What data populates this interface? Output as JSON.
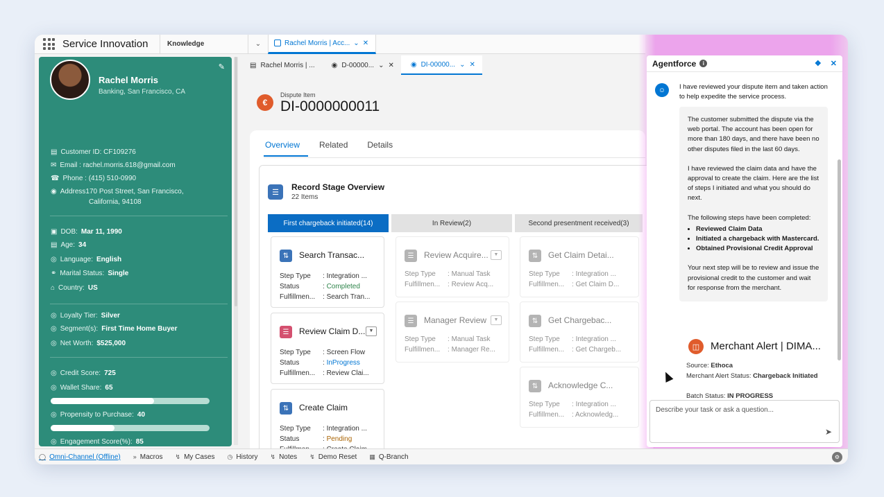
{
  "app": {
    "name": "Service Innovation",
    "nav_dropdown": "Knowledge",
    "workspace_tab": "Rachel Morris | Acc..."
  },
  "subtabs": [
    {
      "label": "Rachel Morris | ..."
    },
    {
      "label": "D-00000..."
    },
    {
      "label": "DI-00000..."
    }
  ],
  "profile": {
    "name": "Rachel Morris",
    "location": "Banking, San Francisco, CA",
    "customer_id": "Customer ID: CF109276",
    "email": "Email : rachel.morris.618@gmail.com",
    "phone": "Phone : (415) 510-0990",
    "address_line1": "Address170 Post Street, San Francisco,",
    "address_line2": "California, 94108",
    "dob_label": "DOB:",
    "dob": "Mar 11, 1990",
    "age_label": "Age:",
    "age": "34",
    "language_label": "Language:",
    "language": "English",
    "marital_label": "Marital Status:",
    "marital": "Single",
    "country_label": "Country:",
    "country": "US",
    "loyalty_label": "Loyalty Tier:",
    "loyalty": "Silver",
    "segment_label": "Segment(s):",
    "segment": "First Time Home Buyer",
    "networth_label": "Net Worth:",
    "networth": "$525,000",
    "credit_label": "Credit Score:",
    "credit": "725",
    "wallet_label": "Wallet Share:",
    "wallet": "65",
    "wallet_fill": 0.65,
    "propensity_label": "Propensity to Purchase:",
    "propensity": "40",
    "propensity_fill": 0.4,
    "engagement_label": "Engagement Score(%):",
    "engagement": "85",
    "engagement_fill": 0.85
  },
  "record": {
    "type": "Dispute Item",
    "title": "DI-0000000011",
    "tabs": [
      "Overview",
      "Related",
      "Details"
    ]
  },
  "stage": {
    "title": "Record Stage Overview",
    "count": "22 Items",
    "columns": [
      "First chargeback initiated(14)",
      "In Review(2)",
      "Second presentment received(3)"
    ],
    "k_step": "Step Type",
    "k_status": "Status",
    "k_fulfil": "Fulfillmen...",
    "col1": [
      {
        "title": "Search Transac...",
        "step": "Integration ...",
        "status": "Completed",
        "fulfil": "Search Tran..."
      },
      {
        "title": "Review Claim D...",
        "step": "Screen Flow",
        "status": "InProgress",
        "fulfil": "Review Clai..."
      },
      {
        "title": "Create Claim",
        "step": "Integration ...",
        "status": "Pending",
        "fulfil": "Create Claim"
      }
    ],
    "col2": [
      {
        "title": "Review Acquire...",
        "step": "Manual Task",
        "fulfil": "Review Acq..."
      },
      {
        "title": "Manager Review",
        "step": "Manual Task",
        "fulfil": "Manager Re..."
      }
    ],
    "col3": [
      {
        "title": "Get Claim Detai...",
        "step": "Integration ...",
        "fulfil": "Get Claim D..."
      },
      {
        "title": "Get Chargebac...",
        "step": "Integration ...",
        "fulfil": "Get Chargeb..."
      },
      {
        "title": "Acknowledge C...",
        "step": "Integration ...",
        "fulfil": "Acknowledg..."
      }
    ]
  },
  "agent": {
    "title": "Agentforce",
    "intro": "I have reviewed your dispute item and taken action to help expedite the service process.",
    "p1": "The customer submitted the dispute via the web portal. The account has been open for more than 180 days, and there have been no other disputes filed in the last 60 days.",
    "p2": "I have reviewed the claim data and have the approval to create the claim. Here are the list of steps I initiated and what you should do next.",
    "p3": "The following steps have been completed:",
    "steps": [
      "Reviewed Claim Data",
      "Initiated a chargeback with Mastercard.",
      "Obtained Provisional Credit Approval"
    ],
    "p4": "Your next step will be to review and issue the provisional credit to the customer and wait for response from the merchant.",
    "merchant_title": "Merchant Alert | DIMA...",
    "source_label": "Source:",
    "source": "Ethoca",
    "alert_status_label": "Merchant Alert Status:",
    "alert_status": "Chargeback Initiated",
    "batch_status_label": "Batch Status:",
    "batch_status": "IN PROGRESS",
    "input_placeholder": "Describe your task or ask a question..."
  },
  "bottombar": {
    "items": [
      "Omni-Channel (Offline)",
      "Macros",
      "My Cases",
      "History",
      "Notes",
      "Demo Reset",
      "Q-Branch"
    ]
  },
  "colors": {
    "brand_blue": "#0176d3",
    "profile_green": "#2d8c7a",
    "agent_glow": "#e664e6"
  }
}
